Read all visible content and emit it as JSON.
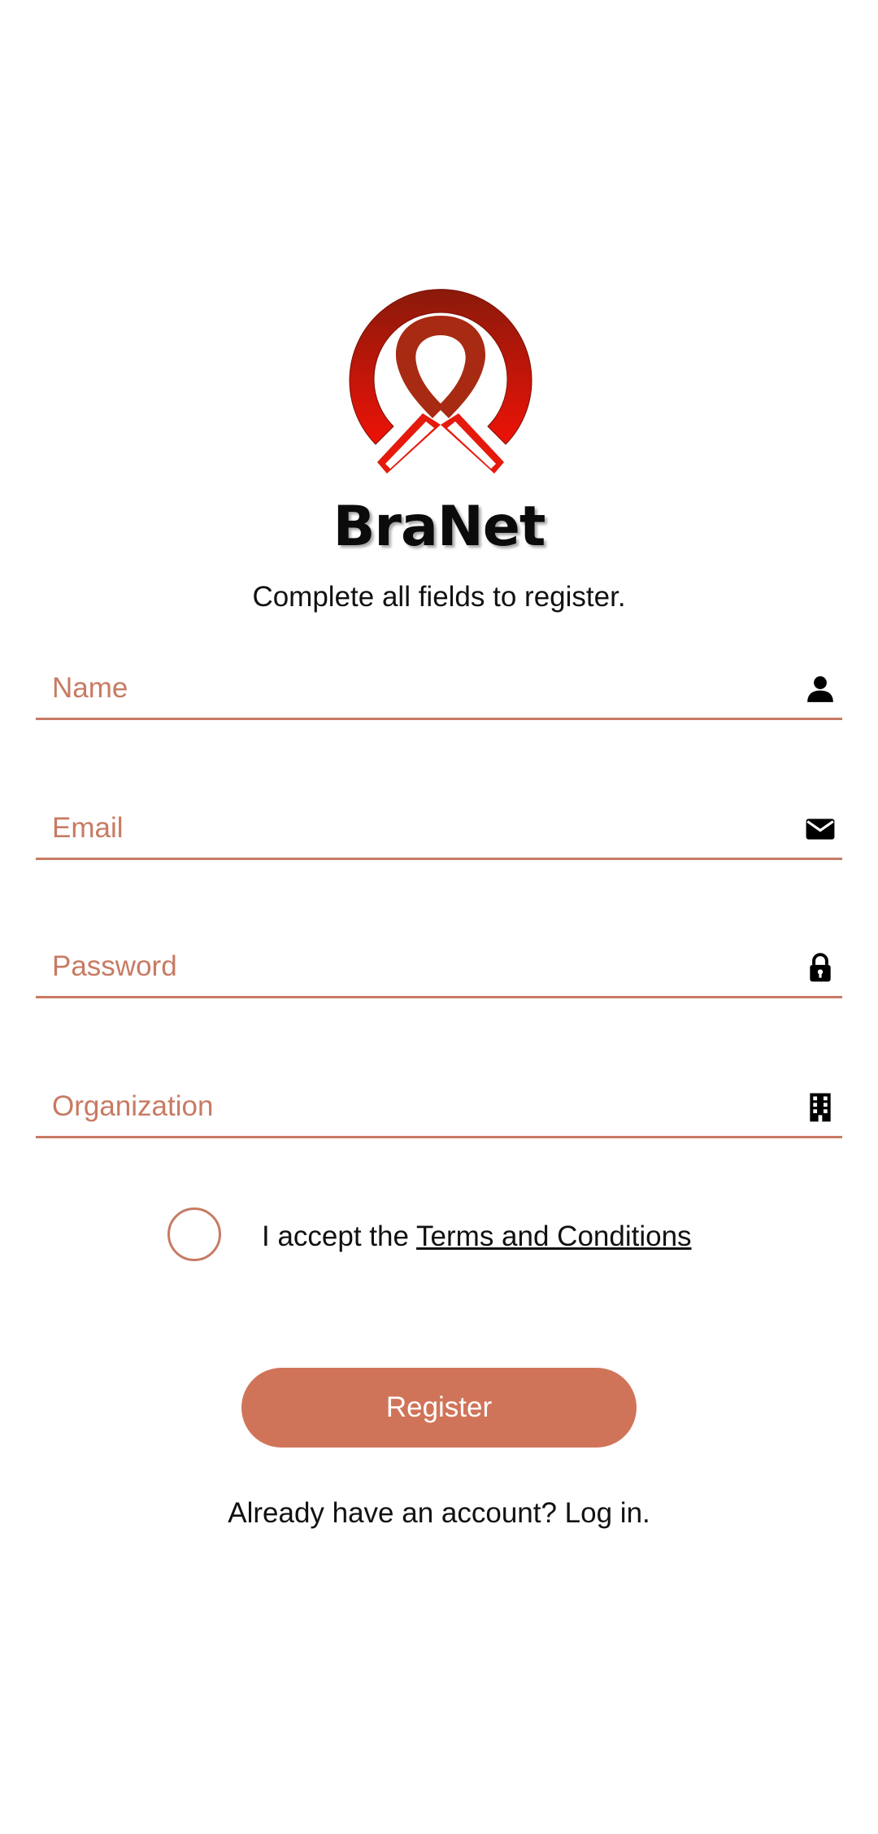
{
  "brand": {
    "name": "BraNet",
    "logo_icon": "red-ribbon-circle-logo",
    "logo_colors": [
      "#8a1a0a",
      "#e01010"
    ]
  },
  "subtitle": "Complete all fields to register.",
  "form": {
    "name": {
      "placeholder": "Name",
      "value": "",
      "icon": "person-icon"
    },
    "email": {
      "placeholder": "Email",
      "value": "",
      "icon": "envelope-icon"
    },
    "password": {
      "placeholder": "Password",
      "value": "",
      "icon": "lock-icon"
    },
    "organization": {
      "placeholder": "Organization",
      "value": "",
      "icon": "building-icon"
    }
  },
  "terms": {
    "checked": false,
    "prefix": "I accept the ",
    "link_label": "Terms and Conditions"
  },
  "register_button": {
    "label": "Register"
  },
  "login_prompt": "Already have an account? Log in.",
  "colors": {
    "accent": "#c77b63",
    "button": "#d07459",
    "button_text": "#ffffff"
  }
}
